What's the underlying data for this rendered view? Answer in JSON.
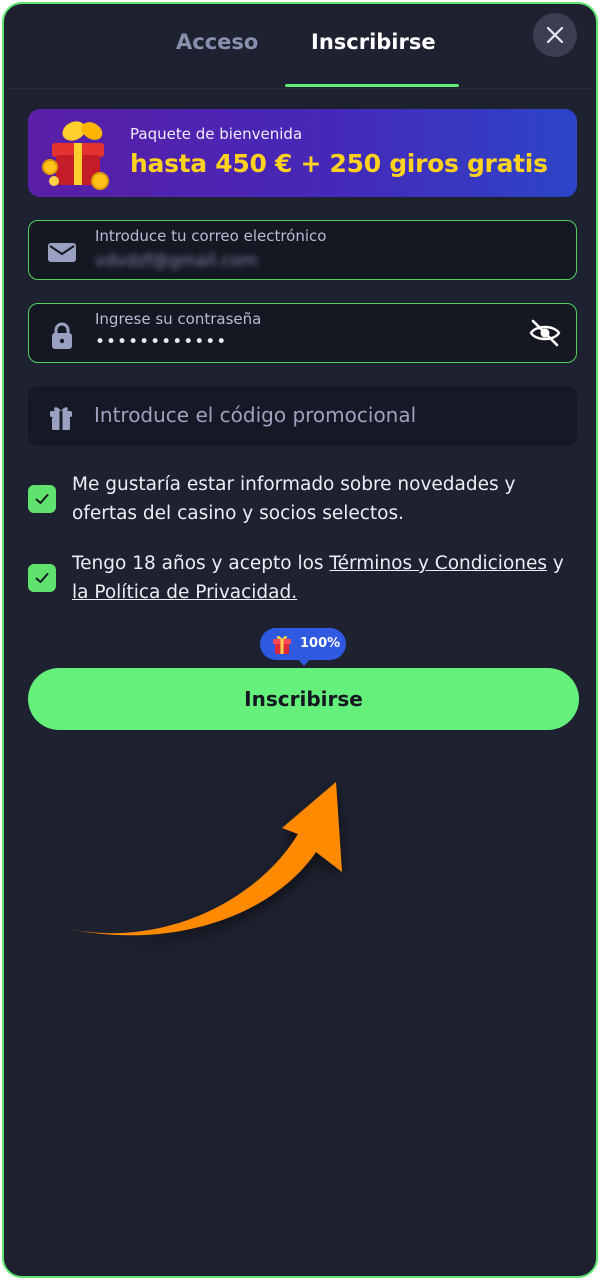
{
  "tabs": {
    "login_label": "Acceso",
    "register_label": "Inscribirse",
    "active": "Inscribirse"
  },
  "banner": {
    "subtitle": "Paquete de bienvenida",
    "headline": "hasta 450 € + 250 giros gratis",
    "icon": "gift-icon"
  },
  "form": {
    "email": {
      "label": "Introduce tu correo electrónico",
      "value": "vdvdzf@gmail.com",
      "icon": "envelope-icon"
    },
    "password": {
      "label": "Ingrese su contraseña",
      "value": "••••••••••••",
      "icon": "lock-icon",
      "toggle_icon": "eye-off-icon"
    },
    "promo": {
      "placeholder": "Introduce el código promocional",
      "icon": "gift-icon"
    }
  },
  "consents": {
    "newsletter": {
      "checked": true,
      "text": "Me gustaría estar informado sobre novedades y ofertas del casino y socios selectos."
    },
    "terms": {
      "checked": true,
      "prefix": "Tengo 18 años y acepto los ",
      "terms_link": "Términos y Condiciones",
      "middle": " y ",
      "privacy_link": "la Política de Privacidad."
    }
  },
  "bonus_badge": {
    "value": "100%",
    "icon": "gift-icon"
  },
  "submit": {
    "label": "Inscribirse"
  },
  "colors": {
    "background": "#1e2130",
    "accent_green": "#64f07a",
    "banner_yellow": "#ffd21f",
    "badge_blue": "#2e59e0",
    "arrow_orange": "#ff8a00"
  }
}
